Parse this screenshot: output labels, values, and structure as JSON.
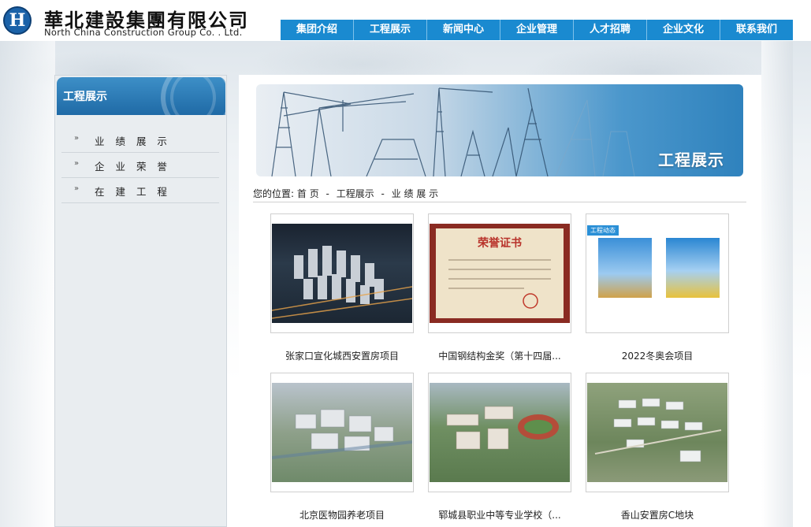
{
  "header": {
    "logo_cn": "華北建設集團有限公司",
    "logo_en": "North China Construction Group Co. . Ltd.",
    "logo_letter": "H",
    "nav": [
      "集团介绍",
      "工程展示",
      "新闻中心",
      "企业管理",
      "人才招聘",
      "企业文化",
      "联系我们"
    ]
  },
  "sidebar": {
    "title": "工程展示",
    "items": [
      "业 绩 展 示",
      "企 业 荣 誉",
      "在 建 工 程"
    ]
  },
  "banner": {
    "title": "工程展示"
  },
  "breadcrumb": {
    "prefix": "您的位置:",
    "home": "首  页",
    "section": "工程展示",
    "current": "业 绩 展 示",
    "separator": "-"
  },
  "projects": [
    {
      "caption": "张家口宣化城西安置房项目",
      "image": "night-residential-render"
    },
    {
      "caption": "中国钢结构金奖（第十四届...",
      "image": "honor-certificate",
      "cert_title": "荣誉证书"
    },
    {
      "caption": "2022冬奥会项目",
      "image": "winter-olympics-photos",
      "tag": "工程动态"
    },
    {
      "caption": "北京医物园养老项目",
      "image": "aerial-campus-render"
    },
    {
      "caption": "郓城县职业中等专业学校（...",
      "image": "school-aerial-render"
    },
    {
      "caption": "香山安置房C地块",
      "image": "residential-aerial-render"
    }
  ],
  "colors": {
    "nav": "#1a8ad0",
    "sidebar_head": "#2b78b4",
    "banner_accent": "#3a8cc6"
  }
}
